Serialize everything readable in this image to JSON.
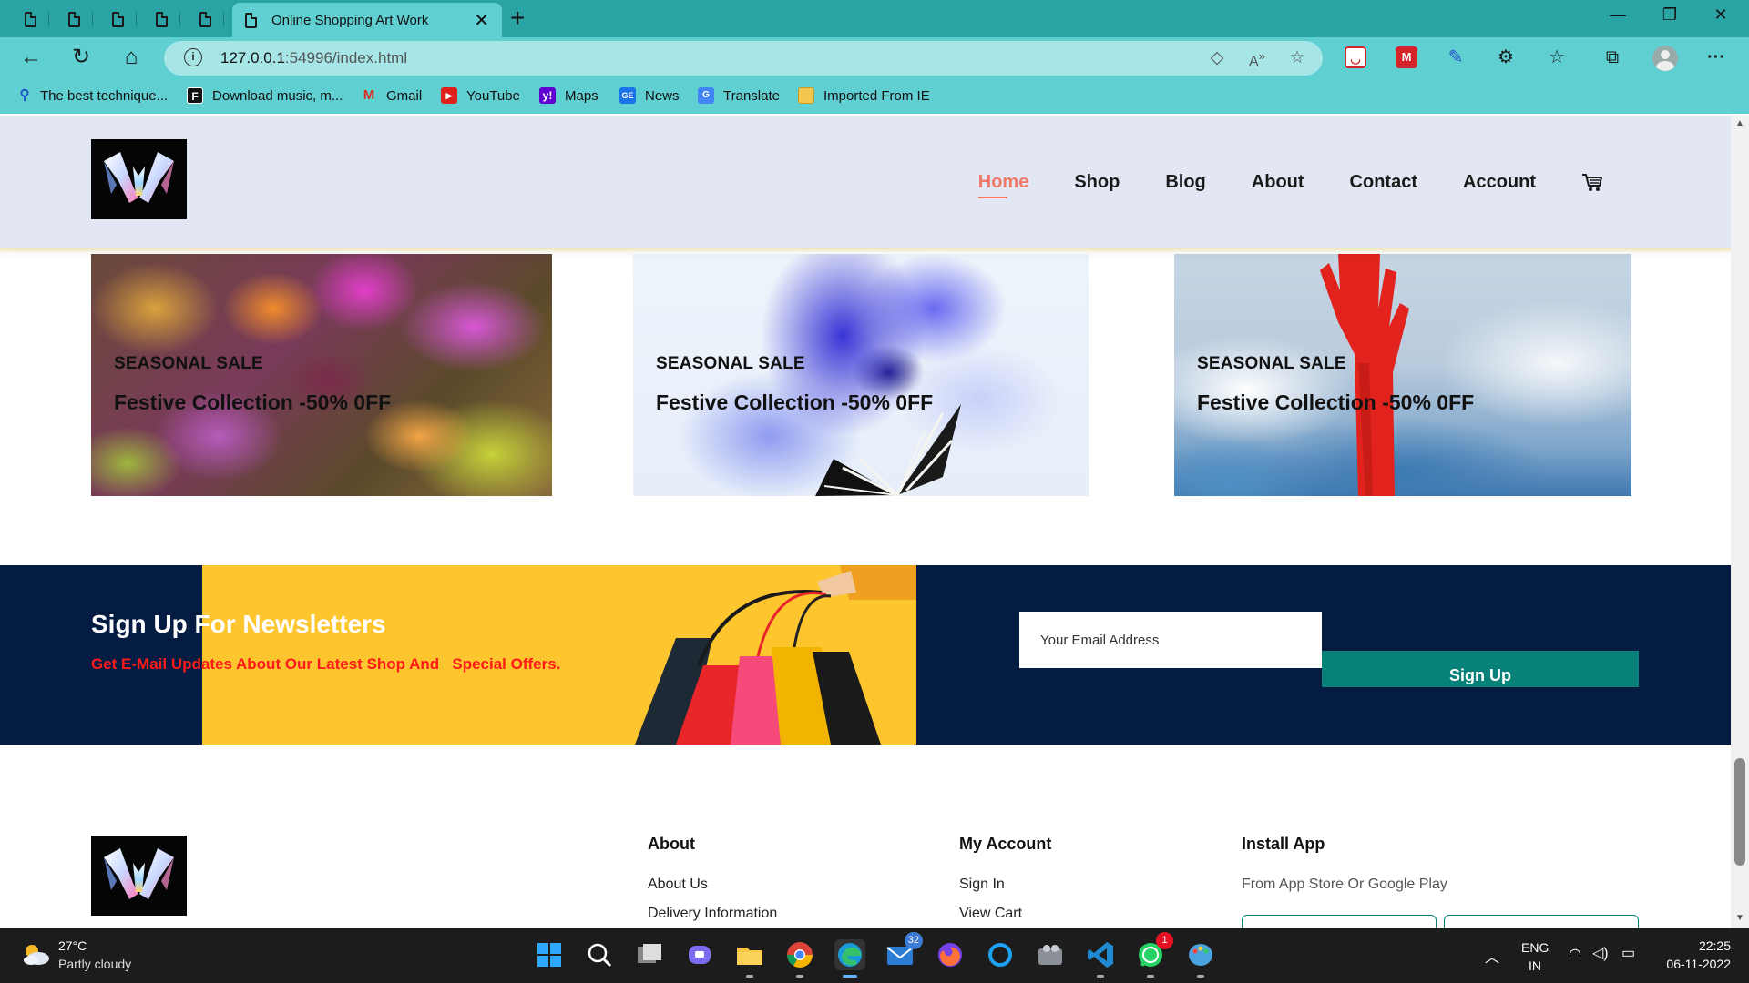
{
  "browser": {
    "tab_title": "Online Shopping Art Work",
    "url_host": "127.0.0.1",
    "url_path": ":54996/index.html",
    "bookmarks": [
      {
        "label": "The best technique...",
        "icon": "search-icon"
      },
      {
        "label": "Download music, m...",
        "icon": "f-logo-icon"
      },
      {
        "label": "Gmail",
        "icon": "gmail-icon"
      },
      {
        "label": "YouTube",
        "icon": "youtube-icon"
      },
      {
        "label": "Maps",
        "icon": "yahoo-icon"
      },
      {
        "label": "News",
        "icon": "news-icon"
      },
      {
        "label": "Translate",
        "icon": "translate-icon"
      },
      {
        "label": "Imported From IE",
        "icon": "folder-icon"
      }
    ]
  },
  "site": {
    "nav": {
      "items": [
        "Home",
        "Shop",
        "Blog",
        "About",
        "Contact",
        "Account"
      ],
      "active": "Home"
    },
    "banners": [
      {
        "tag": "SEASONAL SALE",
        "title": "Festive Collection -50% 0FF"
      },
      {
        "tag": "SEASONAL SALE",
        "title": "Festive Collection -50% 0FF"
      },
      {
        "tag": "SEASONAL SALE",
        "title": "Festive Collection -50% 0FF"
      }
    ],
    "newsletter": {
      "title": "Sign Up For Newsletters",
      "subtitle": "Get E-Mail Updates About Our Latest Shop And   Special Offers.",
      "email_placeholder": "Your Email Address",
      "button_label": "Sign Up"
    },
    "footer": {
      "about": {
        "title": "About",
        "links": [
          "About Us",
          "Delivery Information"
        ]
      },
      "account": {
        "title": "My Account",
        "links": [
          "Sign In",
          "View Cart"
        ]
      },
      "install": {
        "title": "Install App",
        "text": "From App Store Or Google Play"
      }
    }
  },
  "taskbar": {
    "weather_temp": "27°C",
    "weather_desc": "Partly cloudy",
    "mail_badge": "32",
    "whatsapp_badge": "1",
    "lang_top": "ENG",
    "lang_bottom": "IN",
    "time": "22:25",
    "date": "06-11-2022"
  },
  "colors": {
    "tabbar": "#2aa3a5",
    "toolbar": "#5fcfd1",
    "header_bg": "#e3e6f3",
    "nav_active": "#f07a6a",
    "newsletter_bg": "#041c42",
    "newsletter_subtitle": "#ff1a1a",
    "signup_button": "#088178"
  }
}
